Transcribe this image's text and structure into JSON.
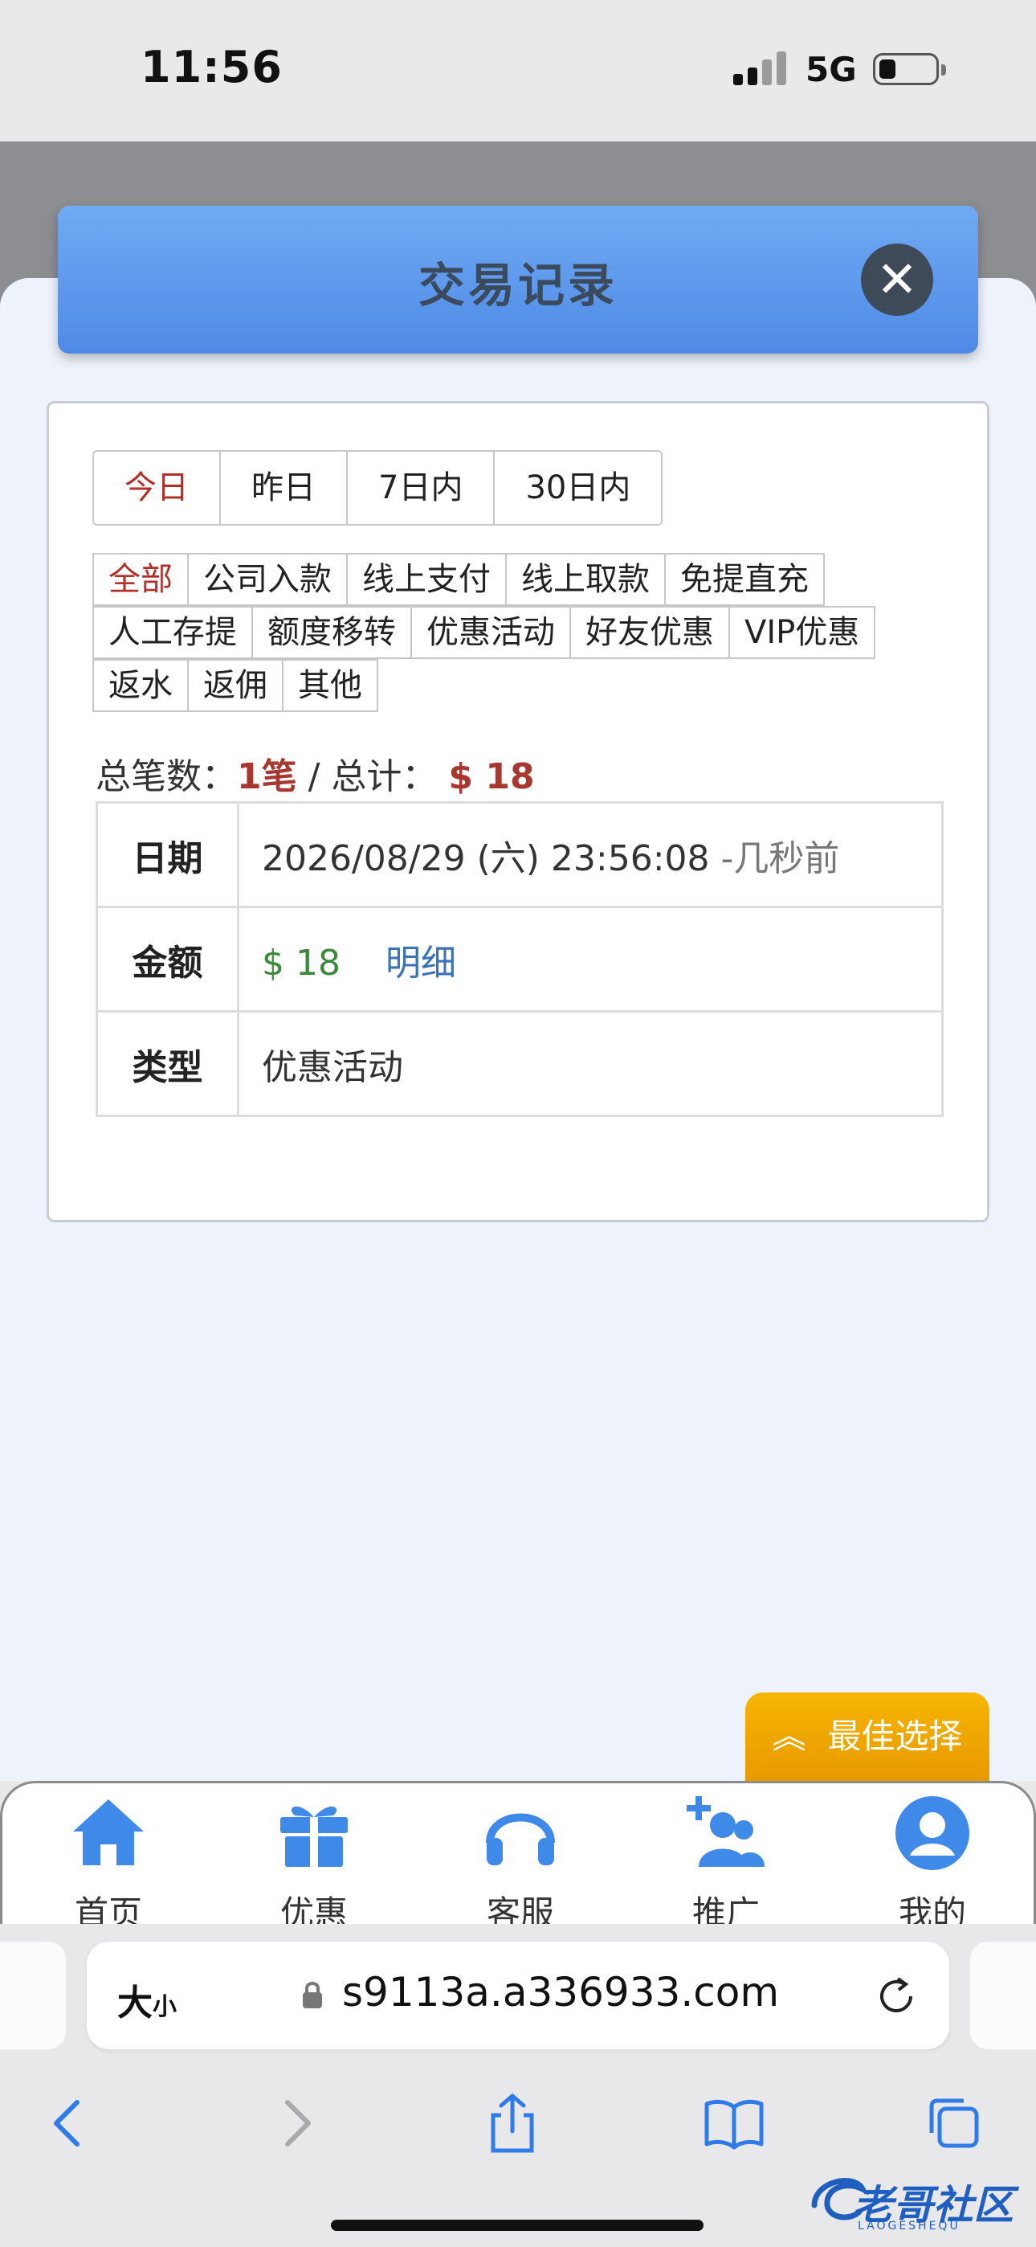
{
  "status_bar": {
    "time": "11:56",
    "network": "5G"
  },
  "modal": {
    "title": "交易记录",
    "close_icon": "close-icon"
  },
  "day_tabs": [
    "今日",
    "昨日",
    "7日内",
    "30日内"
  ],
  "type_filters": {
    "row1": [
      "全部",
      "公司入款",
      "线上支付",
      "线上取款",
      "免提直充"
    ],
    "row2": [
      "人工存提",
      "额度移转",
      "优惠活动",
      "好友优惠",
      "VIP优惠"
    ],
    "row3": [
      "返水",
      "返佣",
      "其他"
    ]
  },
  "summary": {
    "count_label": "总笔数：",
    "count_value": "1笔",
    "separator": " / ",
    "total_label": "总计：",
    "total_value": "$ 18"
  },
  "record": {
    "date_label": "日期",
    "date_value": "2026/08/29 (六) 23:56:08",
    "date_ago": " -几秒前",
    "amount_label": "金额",
    "amount_value": "$ 18",
    "detail_link": "明细",
    "type_label": "类型",
    "type_value": "优惠活动"
  },
  "best_choice_button": "最佳选择",
  "tabbar": [
    {
      "label": "首页",
      "icon": "home-icon"
    },
    {
      "label": "优惠",
      "icon": "gift-icon"
    },
    {
      "label": "客服",
      "icon": "headset-icon"
    },
    {
      "label": "推广",
      "icon": "add-user-icon"
    },
    {
      "label": "我的",
      "icon": "profile-icon"
    }
  ],
  "browser": {
    "text_size_label": "大",
    "text_size_small": "小",
    "url": "s9113a.a336933.com"
  },
  "watermark": {
    "text": "老哥社区",
    "sub": "LAOGESHEQU"
  },
  "colors": {
    "accent_blue": "#4e8ae6",
    "active_red": "#b3302a",
    "amount_green": "#3a8a3a",
    "orange": "#f7b500"
  }
}
